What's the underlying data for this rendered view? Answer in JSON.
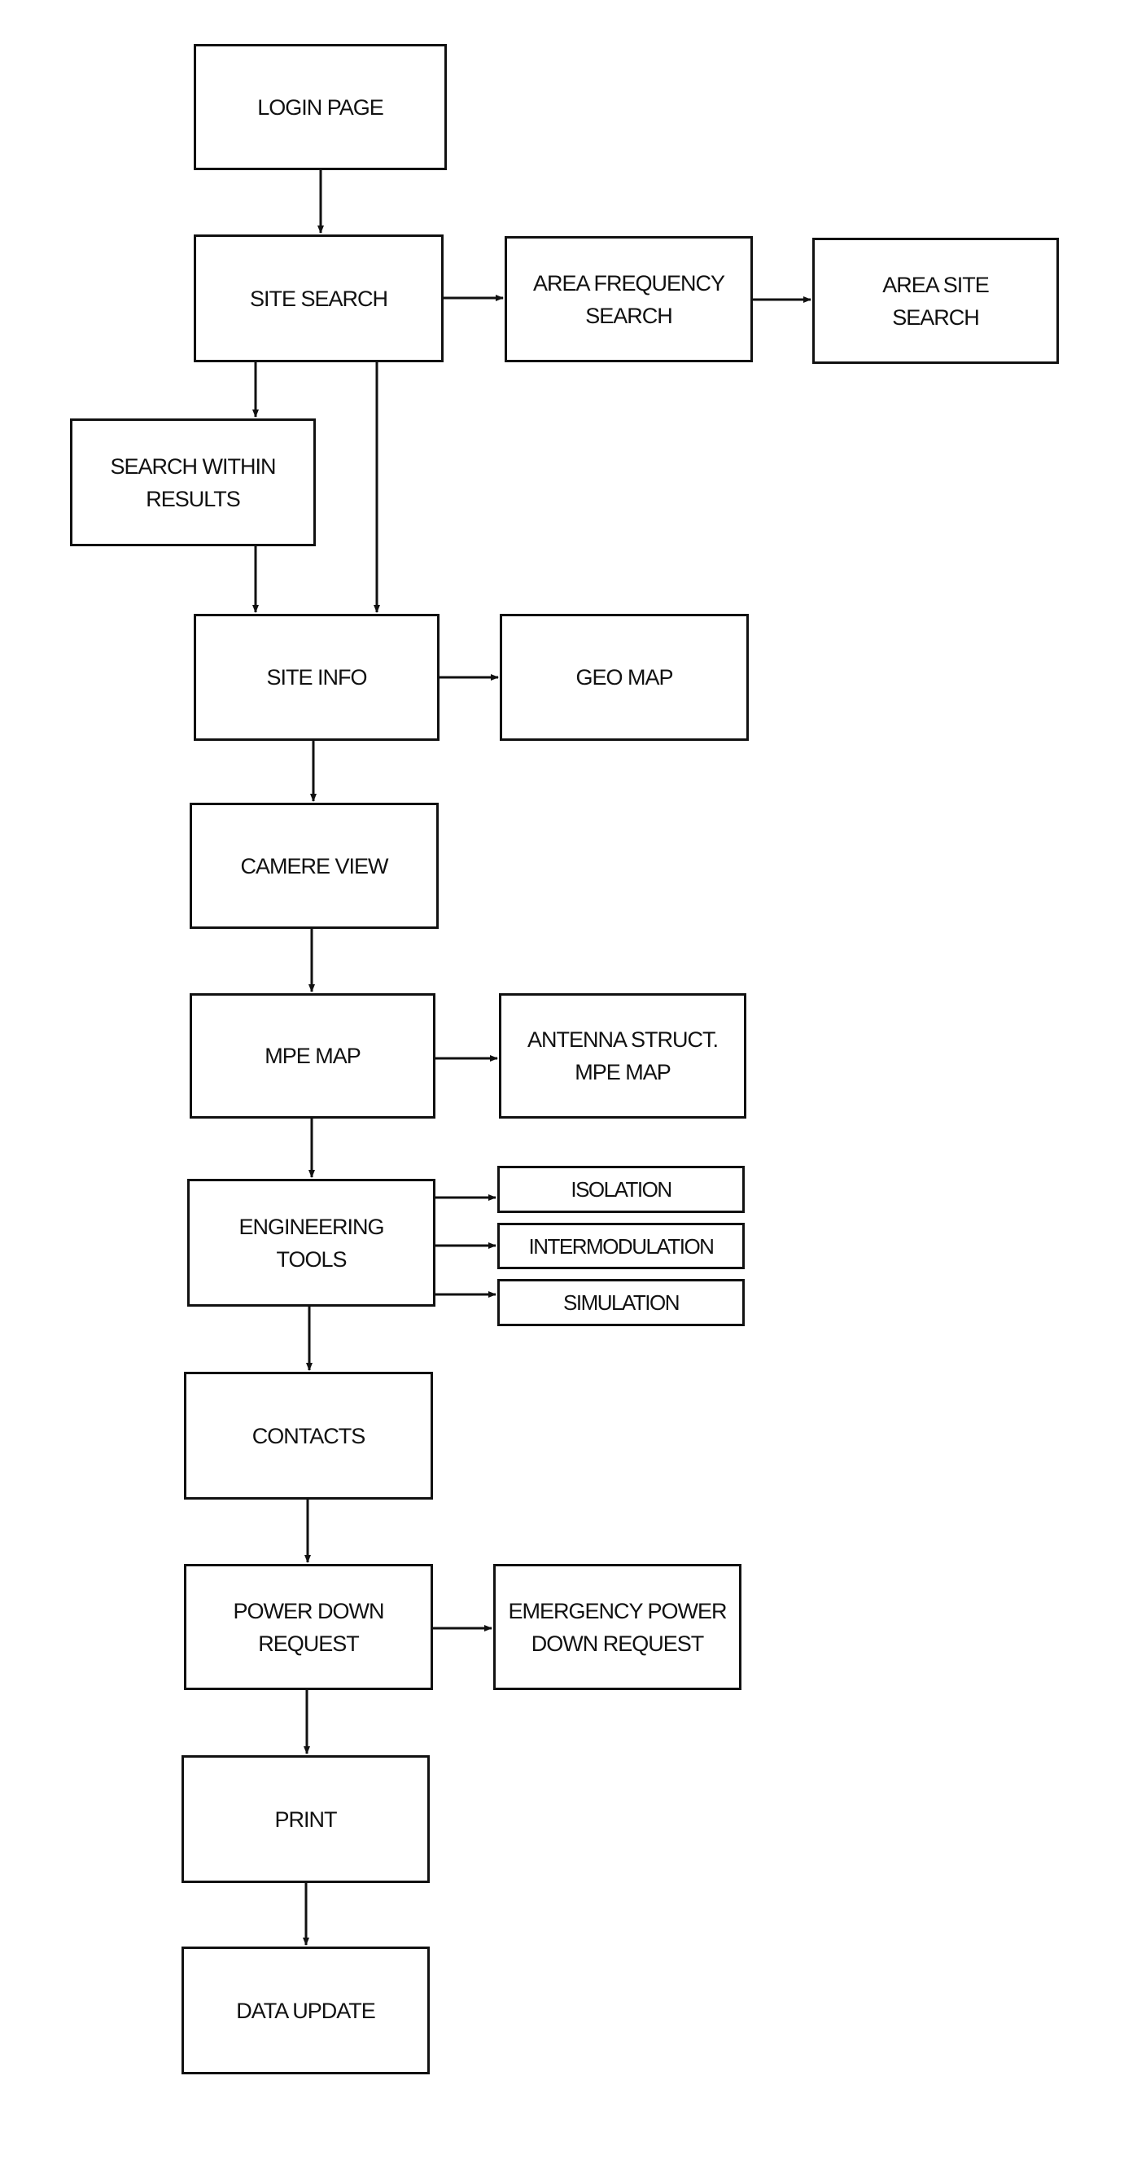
{
  "diagram": {
    "nodes": [
      {
        "id": "login",
        "label": "LOGIN PAGE"
      },
      {
        "id": "site_search",
        "label": "SITE SEARCH"
      },
      {
        "id": "area_freq",
        "label": "AREA FREQUENCY\nSEARCH"
      },
      {
        "id": "area_site",
        "label": "AREA SITE\nSEARCH"
      },
      {
        "id": "search_within",
        "label": "SEARCH WITHIN\nRESULTS"
      },
      {
        "id": "site_info",
        "label": "SITE INFO"
      },
      {
        "id": "geo_map",
        "label": "GEO MAP"
      },
      {
        "id": "camere_view",
        "label": "CAMERE VIEW"
      },
      {
        "id": "mpe_map",
        "label": "MPE MAP"
      },
      {
        "id": "antenna_mpe",
        "label": "ANTENNA STRUCT.\nMPE MAP"
      },
      {
        "id": "eng_tools",
        "label": "ENGINEERING\nTOOLS"
      },
      {
        "id": "isolation",
        "label": "ISOLATION"
      },
      {
        "id": "intermod",
        "label": "INTERMODULATION"
      },
      {
        "id": "simulation",
        "label": "SIMULATION"
      },
      {
        "id": "contacts",
        "label": "CONTACTS"
      },
      {
        "id": "power_down",
        "label": "POWER DOWN\nREQUEST"
      },
      {
        "id": "emergency",
        "label": "EMERGENCY POWER\nDOWN REQUEST"
      },
      {
        "id": "print",
        "label": "PRINT"
      },
      {
        "id": "data_update",
        "label": "DATA UPDATE"
      }
    ],
    "edges": [
      [
        "login",
        "site_search"
      ],
      [
        "site_search",
        "area_freq"
      ],
      [
        "area_freq",
        "area_site"
      ],
      [
        "site_search",
        "search_within"
      ],
      [
        "site_search",
        "site_info"
      ],
      [
        "search_within",
        "site_info"
      ],
      [
        "site_info",
        "geo_map"
      ],
      [
        "site_info",
        "camere_view"
      ],
      [
        "camere_view",
        "mpe_map"
      ],
      [
        "mpe_map",
        "antenna_mpe"
      ],
      [
        "mpe_map",
        "eng_tools"
      ],
      [
        "eng_tools",
        "isolation"
      ],
      [
        "eng_tools",
        "intermod"
      ],
      [
        "eng_tools",
        "simulation"
      ],
      [
        "eng_tools",
        "contacts"
      ],
      [
        "contacts",
        "power_down"
      ],
      [
        "power_down",
        "emergency"
      ],
      [
        "power_down",
        "print"
      ],
      [
        "print",
        "data_update"
      ]
    ]
  }
}
